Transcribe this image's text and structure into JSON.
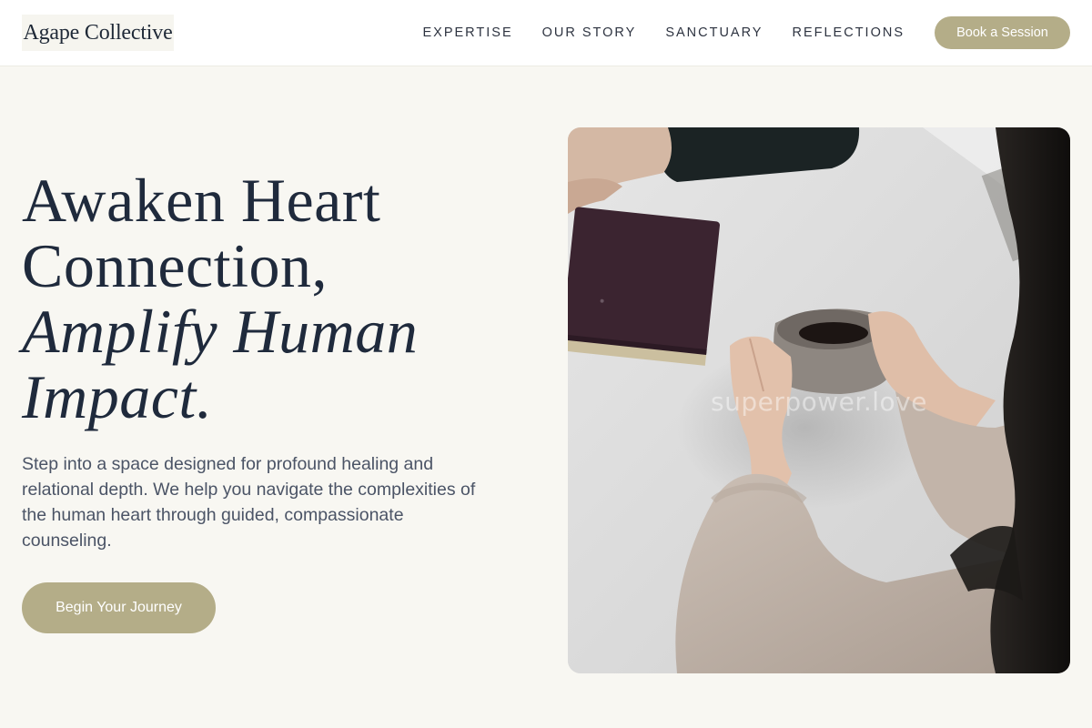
{
  "brand": {
    "name": "Agape Collective"
  },
  "nav": {
    "items": [
      {
        "label": "EXPERTISE"
      },
      {
        "label": "OUR STORY"
      },
      {
        "label": "SANCTUARY"
      },
      {
        "label": "REFLECTIONS"
      }
    ],
    "book_label": "Book a Session"
  },
  "hero": {
    "headline_line1": "Awaken Heart",
    "headline_line2": "Connection,",
    "headline_line3": "Amplify Human",
    "headline_line4": "Impact.",
    "subtext": "Step into a space designed for profound healing and relational depth. We help you navigate the complexities of the human heart through guided, compassionate counseling.",
    "cta_label": "Begin Your Journey",
    "image_watermark": "superpower.love"
  },
  "colors": {
    "accent": "#b4ad88",
    "background": "#f8f7f2",
    "heading": "#1f2a3c"
  }
}
